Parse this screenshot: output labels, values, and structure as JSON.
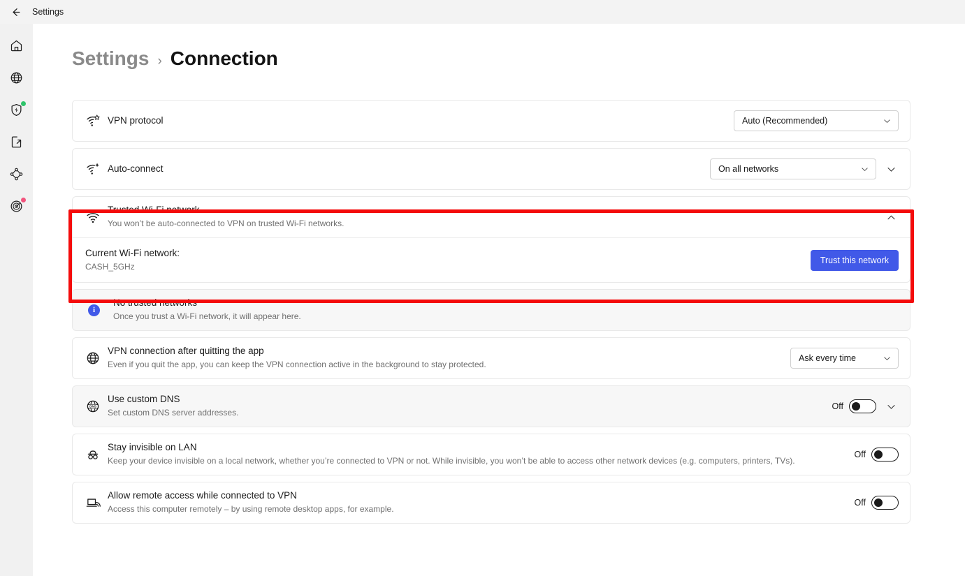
{
  "titlebar": {
    "back_icon": "arrow-left-icon",
    "title": "Settings"
  },
  "sidebar": {
    "items": [
      {
        "icon": "home-icon",
        "name": "home"
      },
      {
        "icon": "globe-icon",
        "name": "locations"
      },
      {
        "icon": "shield-bolt-icon",
        "name": "threat-protection",
        "badge": "#2fc46b"
      },
      {
        "icon": "file-share-icon",
        "name": "file-share"
      },
      {
        "icon": "mesh-network-icon",
        "name": "meshnet"
      },
      {
        "icon": "dark-web-monitor-icon",
        "name": "dark-web-monitor",
        "badge": "#f2547d"
      }
    ]
  },
  "breadcrumb": {
    "root": "Settings",
    "separator": "›",
    "current": "Connection"
  },
  "rows": {
    "vpn_protocol": {
      "icon": "wifi-star-icon",
      "title": "VPN protocol",
      "select_value": "Auto (Recommended)"
    },
    "auto_connect": {
      "icon": "wifi-sparkle-icon",
      "title": "Auto-connect",
      "select_value": "On all networks",
      "expand_icon": "chevron-down-icon"
    },
    "trusted_wifi": {
      "icon": "wifi-icon",
      "title": "Trusted Wi-Fi network",
      "subtitle": "You won’t be auto-connected to VPN on trusted Wi-Fi networks.",
      "collapse_icon": "chevron-up-icon",
      "current_label": "Current Wi-Fi network:",
      "current_value": "CASH_5GHz",
      "trust_button": "Trust this network"
    },
    "no_trusted": {
      "icon": "info-icon",
      "title": "No trusted networks",
      "subtitle": "Once you trust a Wi-Fi network, it will appear here."
    },
    "vpn_after_quit": {
      "icon": "globe-icon",
      "title": "VPN connection after quitting the app",
      "subtitle": "Even if you quit the app, you can keep the VPN connection active in the background to stay protected.",
      "select_value": "Ask every time"
    },
    "custom_dns": {
      "icon": "dns-globe-icon",
      "title": "Use custom DNS",
      "subtitle": "Set custom DNS server addresses.",
      "toggle_state": "Off",
      "expand_icon": "chevron-down-icon"
    },
    "invisible_lan": {
      "icon": "incognito-icon",
      "title": "Stay invisible on LAN",
      "subtitle": "Keep your device invisible on a local network, whether you’re connected to VPN or not. While invisible, you won’t be able to access other network devices (e.g. computers, printers, TVs).",
      "toggle_state": "Off"
    },
    "remote_access": {
      "icon": "remote-device-icon",
      "title": "Allow remote access while connected to VPN",
      "subtitle": "Access this computer remotely – by using remote desktop apps, for example.",
      "toggle_state": "Off"
    }
  },
  "colors": {
    "accent_blue": "#4159e8",
    "highlight_red": "#f40b0b",
    "badge_green": "#2fc46b",
    "badge_red": "#f2547d"
  }
}
